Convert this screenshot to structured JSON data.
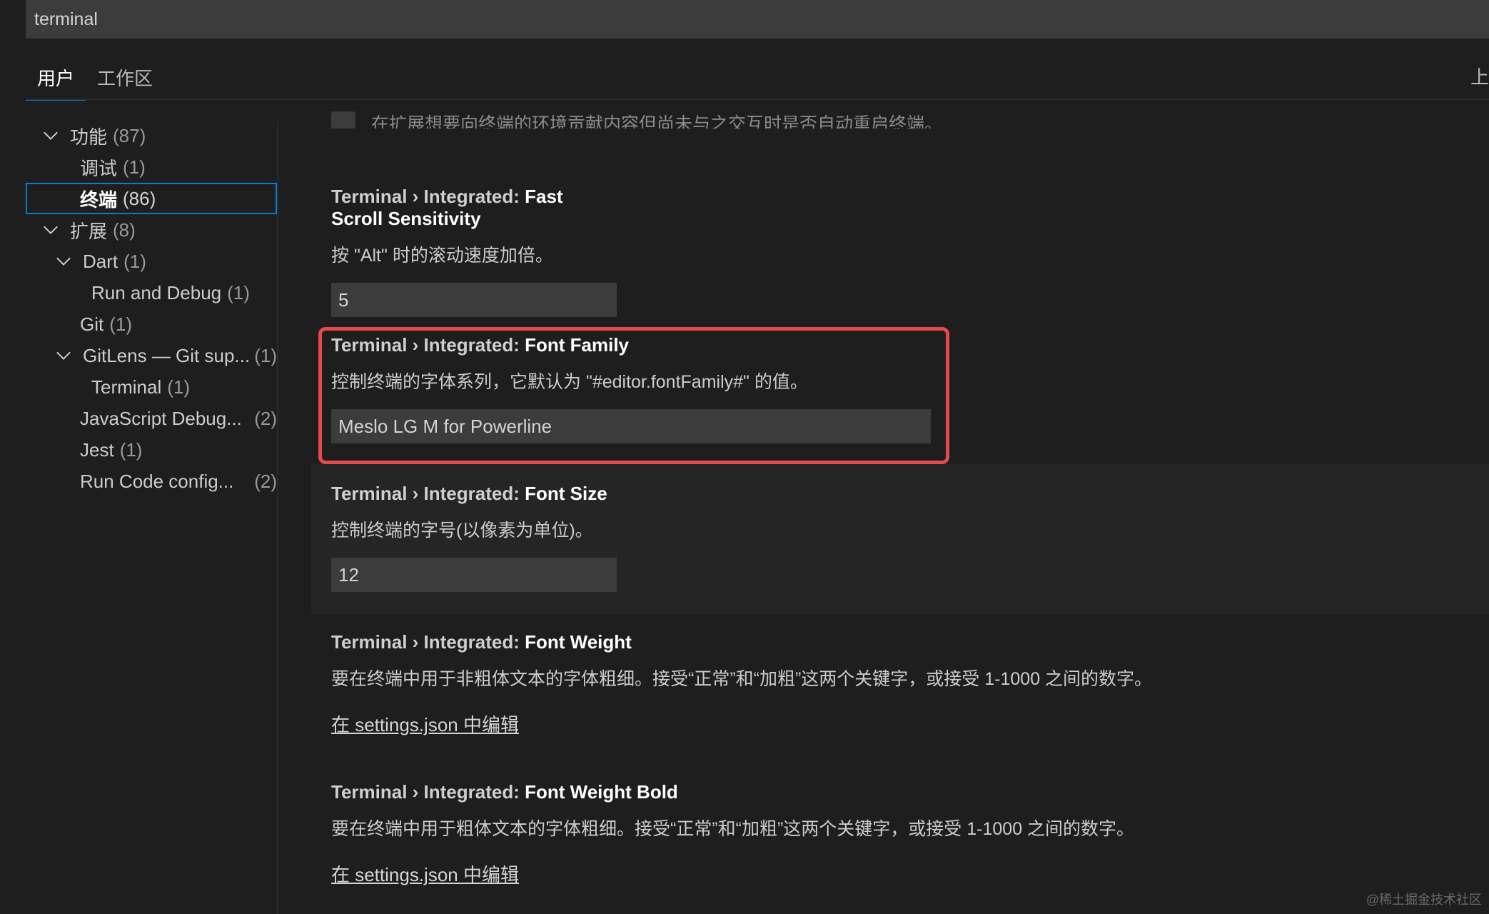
{
  "search": {
    "value": "terminal"
  },
  "tabs": [
    {
      "label": "用户",
      "active": true
    },
    {
      "label": "工作区",
      "active": false
    }
  ],
  "tab_right_label": "上",
  "sidebar": {
    "items": [
      {
        "label": "功能",
        "count": "(87)",
        "level": 0,
        "expanded": true
      },
      {
        "label": "调试",
        "count": "(1)",
        "level": 1
      },
      {
        "label": "终端",
        "count": "(86)",
        "level": 1,
        "selected": true
      },
      {
        "label": "扩展",
        "count": "(8)",
        "level": 0,
        "expanded": true
      },
      {
        "label": "Dart",
        "count": "(1)",
        "level": 1,
        "expanded": true
      },
      {
        "label": "Run and Debug",
        "count": "(1)",
        "level": 2
      },
      {
        "label": "Git",
        "count": "(1)",
        "level": 1
      },
      {
        "label": "GitLens — Git sup...",
        "count": "(1)",
        "level": 1,
        "expanded": true
      },
      {
        "label": "Terminal",
        "count": "(1)",
        "level": 2
      },
      {
        "label": "JavaScript Debug...",
        "count": "(2)",
        "level": 1
      },
      {
        "label": "Jest",
        "count": "(1)",
        "level": 1
      },
      {
        "label": "Run Code config...",
        "count": "(2)",
        "level": 1
      }
    ]
  },
  "partial_setting_text": "在扩展想要向终端的环境贡献内容但尚未与之交互时是否自动重启终端。",
  "settings": [
    {
      "prefix": "Terminal › Integrated: ",
      "name": "Fast Scroll Sensitivity",
      "description": "按 \"Alt\" 时的滚动速度加倍。",
      "value": "5"
    },
    {
      "prefix": "Terminal › Integrated: ",
      "name": "Font Family",
      "description": "控制终端的字体系列，它默认为 \"#editor.fontFamily#\" 的值。",
      "value": "Meslo LG M for Powerline"
    },
    {
      "prefix": "Terminal › Integrated: ",
      "name": "Font Size",
      "description": "控制终端的字号(以像素为单位)。",
      "value": "12"
    },
    {
      "prefix": "Terminal › Integrated: ",
      "name": "Font Weight",
      "description": "要在终端中用于非粗体文本的字体粗细。接受“正常”和“加粗”这两个关键字，或接受 1-1000 之间的数字。",
      "link": "在 settings.json 中编辑"
    },
    {
      "prefix": "Terminal › Integrated: ",
      "name": "Font Weight Bold",
      "description": "要在终端中用于粗体文本的字体粗细。接受“正常”和“加粗”这两个关键字，或接受 1-1000 之间的数字。",
      "link": "在 settings.json 中编辑"
    }
  ],
  "watermark": "@稀土掘金技术社区",
  "colors": {
    "highlight": "#e5484d",
    "focus": "#007fd4",
    "background": "#1e1e1e",
    "input": "#3c3c3c"
  }
}
